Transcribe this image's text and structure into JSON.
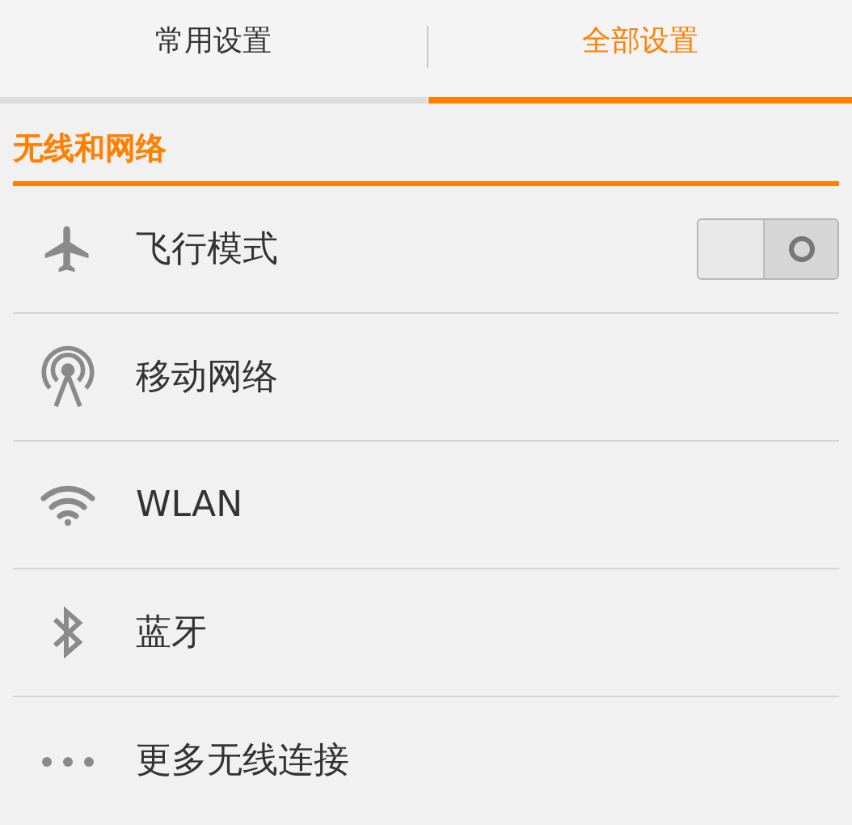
{
  "tabs": [
    {
      "label": "常用设置",
      "selected": false
    },
    {
      "label": "全部设置",
      "selected": true
    }
  ],
  "section": {
    "title": "无线和网络"
  },
  "rows": [
    {
      "kind": "toggle",
      "label": "飞行模式",
      "on": false
    },
    {
      "kind": "plain",
      "label": "移动网络"
    },
    {
      "kind": "plain",
      "label": "WLAN"
    },
    {
      "kind": "plain",
      "label": "蓝牙"
    },
    {
      "kind": "plain",
      "label": "更多无线连接"
    }
  ]
}
